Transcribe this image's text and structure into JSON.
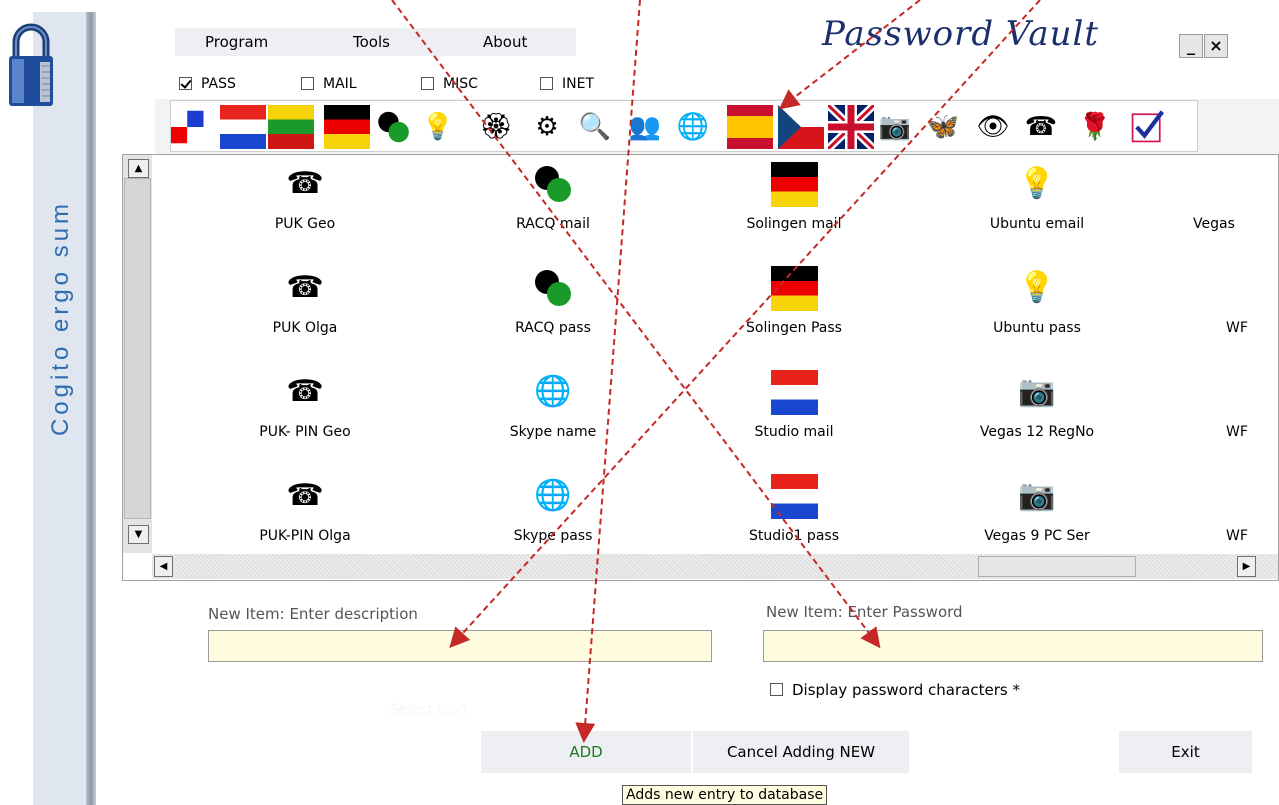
{
  "app": {
    "title": "Password Vault",
    "side_text": "Cogito ergo sum"
  },
  "menu": [
    "Program",
    "Tools",
    "About"
  ],
  "window_controls": {
    "minimize": "_",
    "close": "×"
  },
  "filters": [
    {
      "label": "PASS",
      "checked": true
    },
    {
      "label": "MAIL",
      "checked": false
    },
    {
      "label": "MISC",
      "checked": false
    },
    {
      "label": "INET",
      "checked": false
    }
  ],
  "toolbar_icons": [
    "flag-blocks-icon",
    "flag-netherlands-icon",
    "flag-lithuania-icon",
    "flag-germany-icon",
    "dots-icon",
    "lightbulb-icon",
    "rosette-icon",
    "gears-icon",
    "magnifier-icon",
    "figures-icon",
    "globe-icon",
    "flag-spain-icon",
    "flag-czech-icon",
    "flag-uk-icon",
    "camera-icon",
    "butterfly-icon",
    "eye-icon",
    "telephone-icon",
    "rose-icon",
    "checkmark-icon"
  ],
  "list_items": [
    [
      {
        "label": "PUK Geo",
        "icon": "telephone-icon"
      },
      {
        "label": "PUK Olga",
        "icon": "telephone-icon"
      },
      {
        "label": "PUK- PIN Geo",
        "icon": "telephone-icon"
      },
      {
        "label": "PUK-PIN Olga",
        "icon": "telephone-icon"
      }
    ],
    [
      {
        "label": "RACQ mail",
        "icon": "dots-icon"
      },
      {
        "label": "RACQ pass",
        "icon": "dots-icon"
      },
      {
        "label": "Skype name",
        "icon": "globe-icon"
      },
      {
        "label": "Skype pass",
        "icon": "globe-icon"
      }
    ],
    [
      {
        "label": "Solingen mail",
        "icon": "flag-germany-icon"
      },
      {
        "label": "Solingen Pass",
        "icon": "flag-germany-icon"
      },
      {
        "label": "Studio mail",
        "icon": "flag-netherlands-icon"
      },
      {
        "label": "Studio1 pass",
        "icon": "flag-netherlands-icon"
      }
    ],
    [
      {
        "label": "Ubuntu email",
        "icon": "lightbulb-icon"
      },
      {
        "label": "Ubuntu pass",
        "icon": "lightbulb-icon"
      },
      {
        "label": "Vegas 12 RegNo",
        "icon": "camera-icon"
      },
      {
        "label": "Vegas 9 PC Ser",
        "icon": "camera-icon"
      }
    ],
    [
      {
        "label": "Vegas",
        "icon": ""
      },
      {
        "label": "WF",
        "icon": ""
      },
      {
        "label": "WF",
        "icon": ""
      },
      {
        "label": "WF",
        "icon": ""
      }
    ]
  ],
  "form": {
    "description_caption": "New Item: Enter description",
    "description_value": "",
    "password_caption": "New Item: Enter Password",
    "password_value": "",
    "show_password_label": "Display password characters *",
    "show_password_checked": false,
    "select_icon_note": "Select Icon"
  },
  "buttons": {
    "add": "ADD",
    "cancel": "Cancel Adding NEW",
    "exit": "Exit"
  },
  "tooltip": "Adds new entry to database",
  "colors": {
    "title": "#1a2f6c",
    "side_text": "#2f6cae",
    "add_text": "#1c7a1c",
    "input_bg": "#fefbdf",
    "arrow": "#c62828"
  }
}
